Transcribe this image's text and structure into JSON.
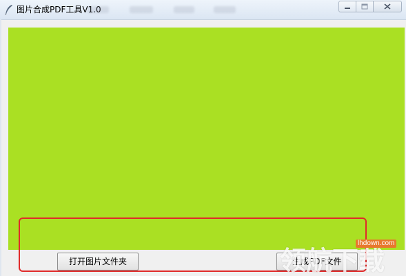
{
  "window": {
    "title": "图片合成PDF工具V1.0",
    "controls": {
      "minimize": "minimize-icon",
      "maximize": "maximize-icon",
      "close": "close-icon"
    }
  },
  "canvas": {
    "color": "#aae023"
  },
  "buttons": {
    "open_folder": "打开图片文件夹",
    "generate_pdf": "生成PDF文件"
  },
  "highlight": {
    "color": "#e02a2a"
  },
  "watermark": {
    "text": "领航下载",
    "site": "lhdown.com"
  }
}
